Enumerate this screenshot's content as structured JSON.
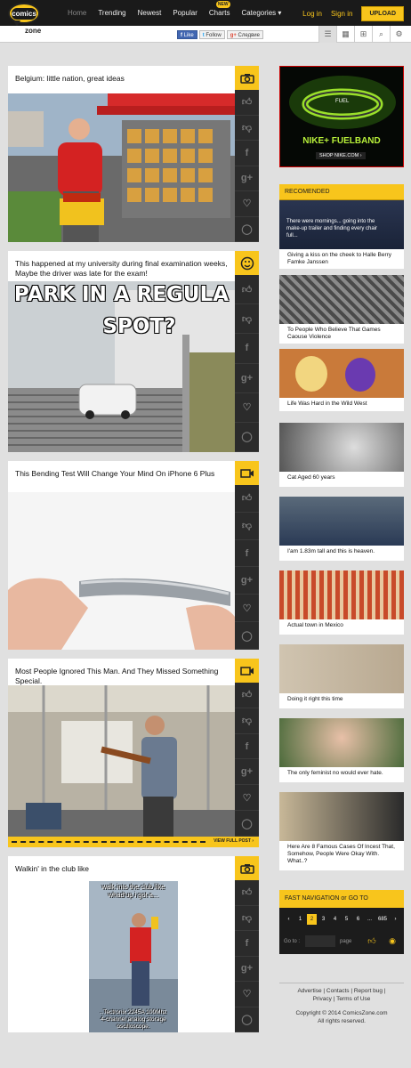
{
  "header": {
    "logo_text": "comics",
    "logo_sub": "zone",
    "nav": [
      {
        "label": "Home"
      },
      {
        "label": "Trending"
      },
      {
        "label": "Newest"
      },
      {
        "label": "Popular"
      },
      {
        "label": "Charts"
      },
      {
        "label": "Categories ▾"
      }
    ],
    "new_badge": "NEW",
    "login": "Log in",
    "signup": "Sign in",
    "upload": "UPLOAD"
  },
  "subbar": {
    "fb_like": "Like",
    "tw_follow": "Follow",
    "gplus": "Следвие"
  },
  "posts": [
    {
      "title": "Belgium: little nation, great ideas",
      "type_icon": "camera-icon"
    },
    {
      "title": "This happened at my university during final examination weeks, Maybe the driver was late for the exam!",
      "type_icon": "meme-face-icon",
      "meme_line1": "PARK IN A REGULA",
      "meme_line2": "SPOT?"
    },
    {
      "title": "This Bending Test Will Change Your Mind On iPhone 6 Plus",
      "type_icon": "video-icon"
    },
    {
      "title": "Most People Ignored This Man. And They Missed Something Special.",
      "type_icon": "video-icon",
      "view_full": "VIEW FULL POST ›"
    },
    {
      "title": "Walkin' in the club like",
      "type_icon": "camera-icon",
      "meme_top": "walk into the club like\nwhad'up i got a...",
      "meme_bottom": "..Tectronix 2245A 100Mhz\n4-channel analog storage\noscilloscope."
    }
  ],
  "ad": {
    "line1": "FUEL",
    "line2": "NIKE+ FUELBAND",
    "line3": "SHOP NIKE.COM ›"
  },
  "recommended": {
    "title": "RECOMENDED",
    "top_caption": "There were mornings... going into the make-up trailer and finding every chair full...",
    "items": [
      {
        "caption": "Giving a kiss on the cheek to Halle Berry Famke Janssen"
      },
      {
        "caption": "To People Who Believe That Games Caouse Violence"
      },
      {
        "caption": "Life Was Hard in the Wild West"
      },
      {
        "caption": "Cat Aged 60 years"
      },
      {
        "caption": "I'am 1.83m tall and this is heaven."
      },
      {
        "caption": "Actual town in Mexico"
      },
      {
        "caption": "Doing it right this time"
      },
      {
        "caption": "The only feminist no would ever hate."
      },
      {
        "caption": "Here Are 8 Famous Cases Of Incest That, Somehow, People Were Okay With. What..?"
      }
    ]
  },
  "fastnav": {
    "title": "FAST NAVIGATION or GO TO",
    "pages": [
      "‹",
      "1",
      "2",
      "3",
      "4",
      "5",
      "6",
      "...",
      "685",
      "›"
    ],
    "current_page": "2",
    "goto_label": "Go to :",
    "page_label": "page"
  },
  "footer": {
    "links": [
      "Advertise",
      "Contacts",
      "Report bug",
      "Privacy",
      "Terms of Use"
    ],
    "copyright": "Copyright © 2014 ComicsZone.com",
    "rights": "All rights reserved."
  },
  "colors": {
    "accent": "#f8c51c",
    "topbar": "#1a1a1a",
    "sidebar": "#2b2b2b"
  }
}
